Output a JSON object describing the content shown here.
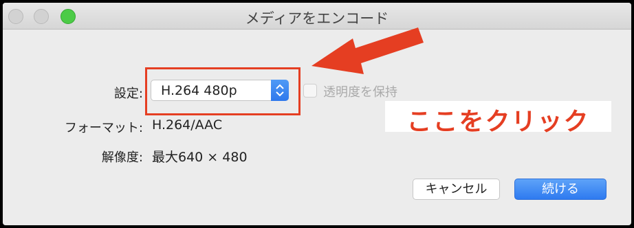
{
  "window": {
    "title": "メディアをエンコード"
  },
  "form": {
    "settings_label": "設定:",
    "settings_value": "H.264 480p",
    "format_label": "フォーマット:",
    "format_value": "H.264/AAC",
    "resolution_label": "解像度:",
    "resolution_value": "最大640 × 480",
    "preserve_transparency_label": "透明度を保持"
  },
  "annotation": {
    "text": "ここをクリック",
    "color": "#e53e22"
  },
  "buttons": {
    "cancel": "キャンセル",
    "continue": "続ける"
  },
  "colors": {
    "accent": "#2f78ec",
    "zoom": "#4ccb47"
  }
}
